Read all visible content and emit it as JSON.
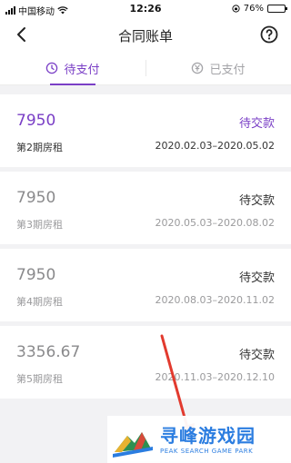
{
  "status_bar": {
    "carrier": "中国移动",
    "time": "12:26",
    "battery": "76%",
    "battery_level": 0.76
  },
  "nav": {
    "title": "合同账单",
    "back_icon": "chevron-left-icon",
    "help_icon": "help-circle-icon"
  },
  "tabs": [
    {
      "label": "待支付",
      "icon": "clock-icon",
      "active": true
    },
    {
      "label": "已支付",
      "icon": "yen-icon",
      "active": false
    }
  ],
  "bills": [
    {
      "amount": "7950",
      "status": "待交款",
      "period": "第2期房租",
      "range": "2020.02.03–2020.05.02"
    },
    {
      "amount": "7950",
      "status": "待交款",
      "period": "第3期房租",
      "range": "2020.05.03–2020.08.02"
    },
    {
      "amount": "7950",
      "status": "待交款",
      "period": "第4期房租",
      "range": "2020.08.03–2020.11.02"
    },
    {
      "amount": "3356.67",
      "status": "待交款",
      "period": "第5期房租",
      "range": "2020.11.03–2020.12.10"
    }
  ],
  "watermark": {
    "title": "寻峰游戏园",
    "subtitle": "PEAK SEARCH GAME PARK"
  },
  "colors": {
    "accent": "#7a3fc6",
    "arrow": "#e23a2e",
    "watermark": "#2b7de0"
  }
}
